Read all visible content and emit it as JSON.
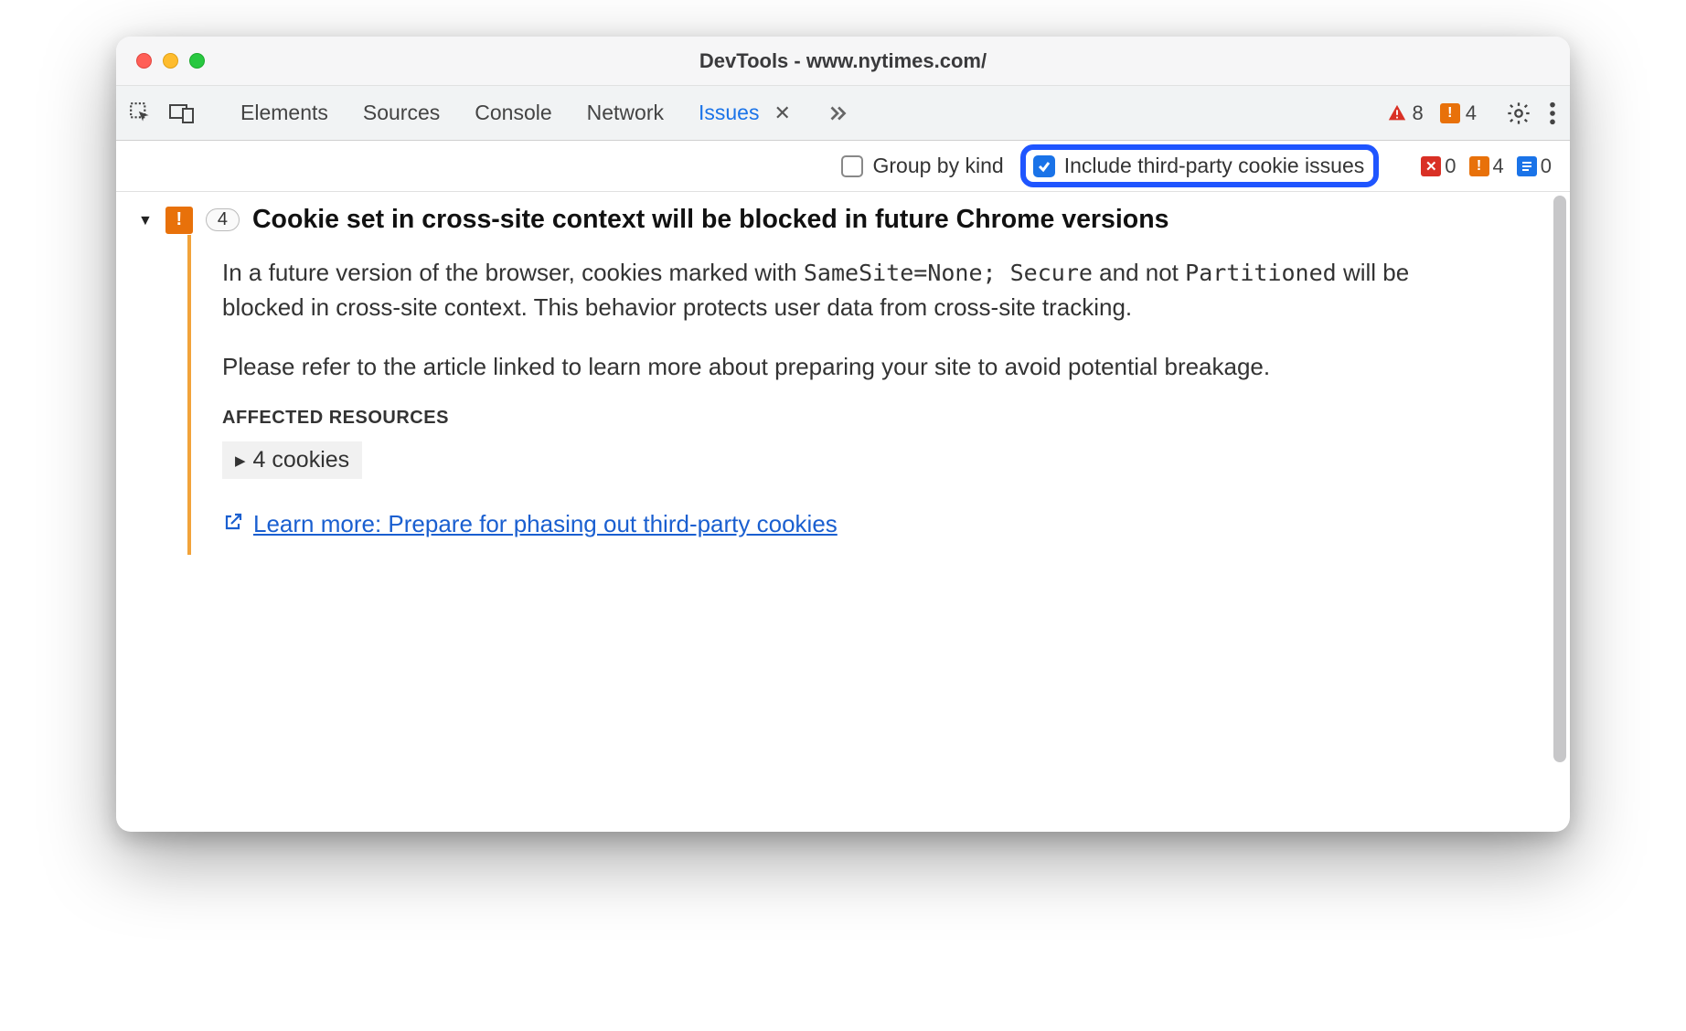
{
  "window": {
    "title": "DevTools - www.nytimes.com/"
  },
  "tabs": {
    "items": [
      "Elements",
      "Sources",
      "Console",
      "Network",
      "Issues"
    ],
    "active_index": 4
  },
  "toolbar_badges": {
    "errors": "8",
    "warnings": "4"
  },
  "filterbar": {
    "group_by_kind": {
      "label": "Group by kind",
      "checked": false
    },
    "include_third_party": {
      "label": "Include third-party cookie issues",
      "checked": true
    },
    "counts": {
      "red": "0",
      "orange": "4",
      "blue": "0"
    }
  },
  "issue": {
    "count": "4",
    "title": "Cookie set in cross-site context will be blocked in future Chrome versions",
    "body_p1_a": "In a future version of the browser, cookies marked with ",
    "body_p1_code1": "SameSite=None; Secure",
    "body_p1_b": " and not ",
    "body_p1_code2": "Partitioned",
    "body_p1_c": " will be blocked in cross-site context. This behavior protects user data from cross-site tracking.",
    "body_p2": "Please refer to the article linked to learn more about preparing your site to avoid potential breakage.",
    "affected_header": "AFFECTED RESOURCES",
    "affected_item": "4 cookies",
    "learn_more": "Learn more: Prepare for phasing out third-party cookies"
  }
}
